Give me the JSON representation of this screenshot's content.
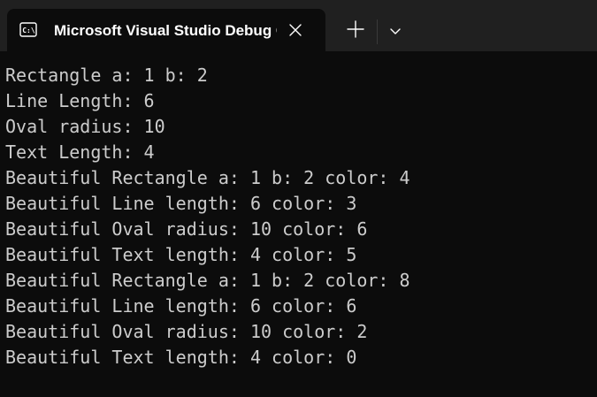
{
  "tab": {
    "title": "Microsoft Visual Studio Debug Console",
    "icon": "terminal-icon",
    "close_icon": "close-icon"
  },
  "toolbar": {
    "new_tab_icon": "plus-icon",
    "dropdown_icon": "chevron-down-icon"
  },
  "console": {
    "lines": [
      "Rectangle a: 1 b: 2",
      "Line Length: 6",
      "Oval radius: 10",
      "Text Length: 4",
      "Beautiful Rectangle a: 1 b: 2 color: 4",
      "Beautiful Line length: 6 color: 3",
      "Beautiful Oval radius: 10 color: 6",
      "Beautiful Text length: 4 color: 5",
      "Beautiful Rectangle a: 1 b: 2 color: 8",
      "Beautiful Line length: 6 color: 6",
      "Beautiful Oval radius: 10 color: 2",
      "Beautiful Text length: 4 color: 0"
    ]
  },
  "colors": {
    "background": "#0c0c0c",
    "titlebar": "#202020",
    "text": "#cccccc",
    "tab_title": "#ffffff"
  }
}
